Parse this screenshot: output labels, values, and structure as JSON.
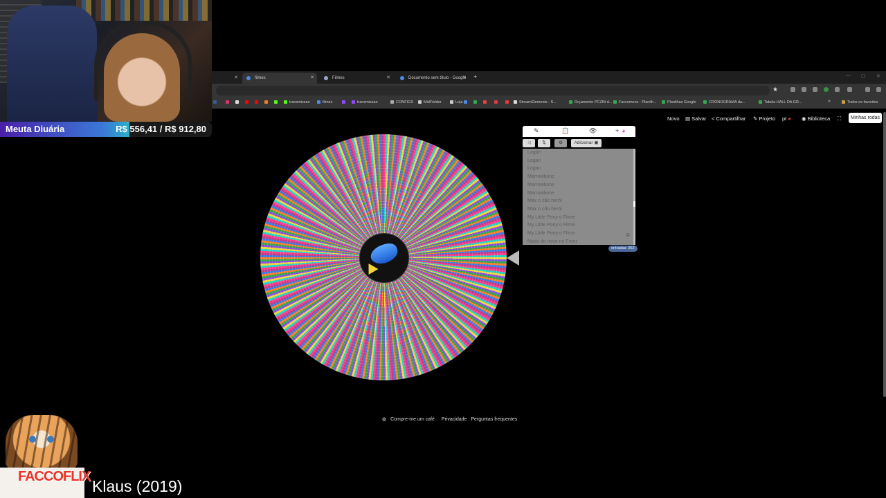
{
  "overlay": {
    "goal_label": "Meuta Diuária",
    "goal_value": "R$ 556,41 / R$ 912,80",
    "goal_progress": 0.61,
    "brand": "FACCOFLIX",
    "now_playing": "Klaus (2019)"
  },
  "browser": {
    "tabs": [
      {
        "label": "",
        "icon_color": "#888888"
      },
      {
        "label": "filmes",
        "icon_color": "#4a8ae8",
        "active": true
      },
      {
        "label": "Filmes",
        "icon_color": "#9aa8c8"
      },
      {
        "label": "Documento sem título - Google",
        "icon_color": "#4a8ae8"
      }
    ],
    "new_tab_label": "+",
    "bookmarks": [
      {
        "label": "",
        "color": "#3b5998"
      },
      {
        "label": "",
        "color": "#e1306c"
      },
      {
        "label": "",
        "color": "#dddddd"
      },
      {
        "label": "",
        "color": "#ff0000"
      },
      {
        "label": "",
        "color": "#ff0000"
      },
      {
        "label": "",
        "color": "#f47b20"
      },
      {
        "label": "",
        "color": "#53fc18"
      },
      {
        "label": "transmissao",
        "color": "#53fc18"
      },
      {
        "label": "filmes",
        "color": "#4a8ae8"
      },
      {
        "label": "",
        "color": "#9146ff"
      },
      {
        "label": "transmissao",
        "color": "#9146ff"
      },
      {
        "label": "CONFIGS",
        "color": "#aaaaaa"
      },
      {
        "label": "MidFielder",
        "color": "#cccccc"
      },
      {
        "label": "Loja",
        "color": "#cccccc"
      },
      {
        "label": "",
        "color": "#4a8ae8"
      },
      {
        "label": "",
        "color": "#34a853"
      },
      {
        "label": "",
        "color": "#ea4335"
      },
      {
        "label": "",
        "color": "#e23a3a"
      },
      {
        "label": "",
        "color": "#e23a3a"
      },
      {
        "label": "StreamElements - S...",
        "color": "#dddddd"
      },
      {
        "label": "Orçamento PCZIN d...",
        "color": "#34a853"
      },
      {
        "label": "Faccomons - Planilh...",
        "color": "#34a853"
      },
      {
        "label": "Planilhas Google",
        "color": "#34a853"
      },
      {
        "label": "CRONOGRAMA da...",
        "color": "#34a853"
      },
      {
        "label": "Tabela HALL DA GR...",
        "color": "#34a853"
      }
    ],
    "bookmarks_more": "»",
    "all_bookmarks": "Todos os favoritos"
  },
  "toolbar": {
    "novo": "Novo",
    "salvar": "Salvar",
    "compartilhar": "Compartilhar",
    "projeto": "Projeto",
    "lang": "pt",
    "biblioteca": "Biblioteca",
    "minhas_rodas": "Minhas rodas"
  },
  "panel": {
    "add_label": "Adicionar",
    "entries": [
      "Logan",
      "Logan",
      "Logan",
      "Marrowbone",
      "Marrowbone",
      "Marrowbone",
      "Max o cão herói",
      "Max o cão herói",
      "My Little Pony o Filme",
      "My Little Pony o Filme",
      "My Little Pony o Filme",
      "Nada de novo no Front"
    ],
    "count_label": "entradas: 352"
  },
  "footer": {
    "coffee": "Compre-me um café",
    "privacy": "Privacidade",
    "faq": "Perguntas frequentes"
  },
  "icons": {
    "pencil": "✎",
    "clipboard": "📋",
    "eye_off": "👁",
    "palette": "◕",
    "shuffle": "⤨",
    "sort": "⇅",
    "gear": "⚙",
    "image": "▣",
    "smiley": "☺",
    "star": "★",
    "fullscreen": "⛶"
  }
}
